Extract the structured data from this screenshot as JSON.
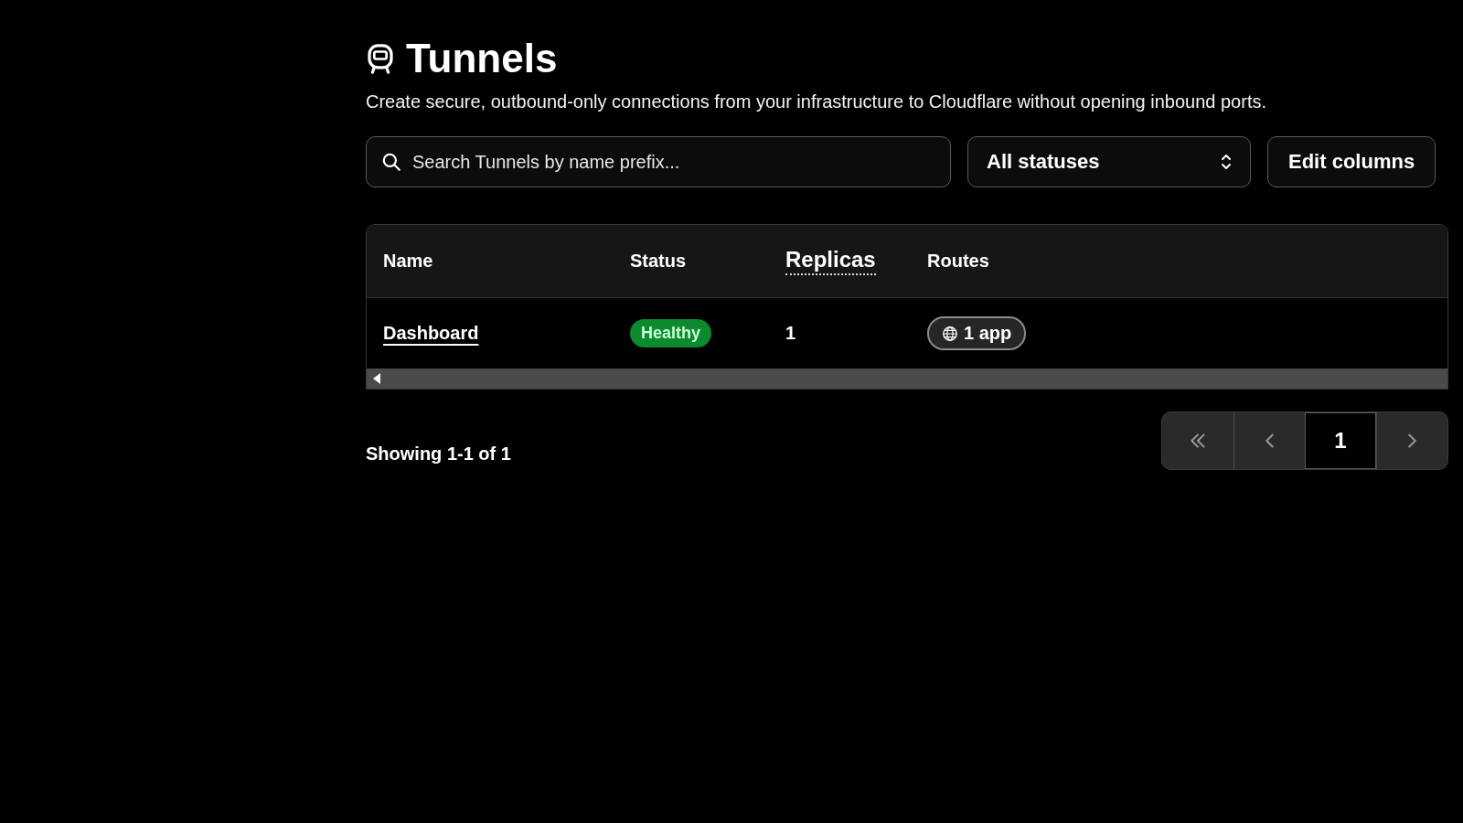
{
  "page": {
    "title": "Tunnels",
    "description": "Create secure, outbound-only connections from your infrastructure to Cloudflare without opening inbound ports."
  },
  "toolbar": {
    "search": {
      "placeholder": "Search Tunnels by name prefix..."
    },
    "status_filter": {
      "value": "All statuses"
    },
    "edit_columns_button": "Edit columns"
  },
  "table": {
    "columns": [
      {
        "label": "Name",
        "kind": "plain"
      },
      {
        "label": "Status",
        "kind": "plain"
      },
      {
        "label": "Replicas",
        "kind": "tooltip"
      },
      {
        "label": "Routes",
        "kind": "plain"
      }
    ],
    "rows": [
      {
        "name": "Dashboard",
        "status": {
          "label": "Healthy",
          "kind": "healthy"
        },
        "replicas": "1",
        "routes": "1 app"
      }
    ]
  },
  "footer": {
    "summary": "Showing 1-1 of 1",
    "pagination": [
      {
        "kind": "first",
        "selected": false
      },
      {
        "kind": "prev",
        "selected": false
      },
      {
        "kind": "page",
        "label": "1",
        "selected": true
      },
      {
        "kind": "next",
        "selected": false
      }
    ]
  }
}
